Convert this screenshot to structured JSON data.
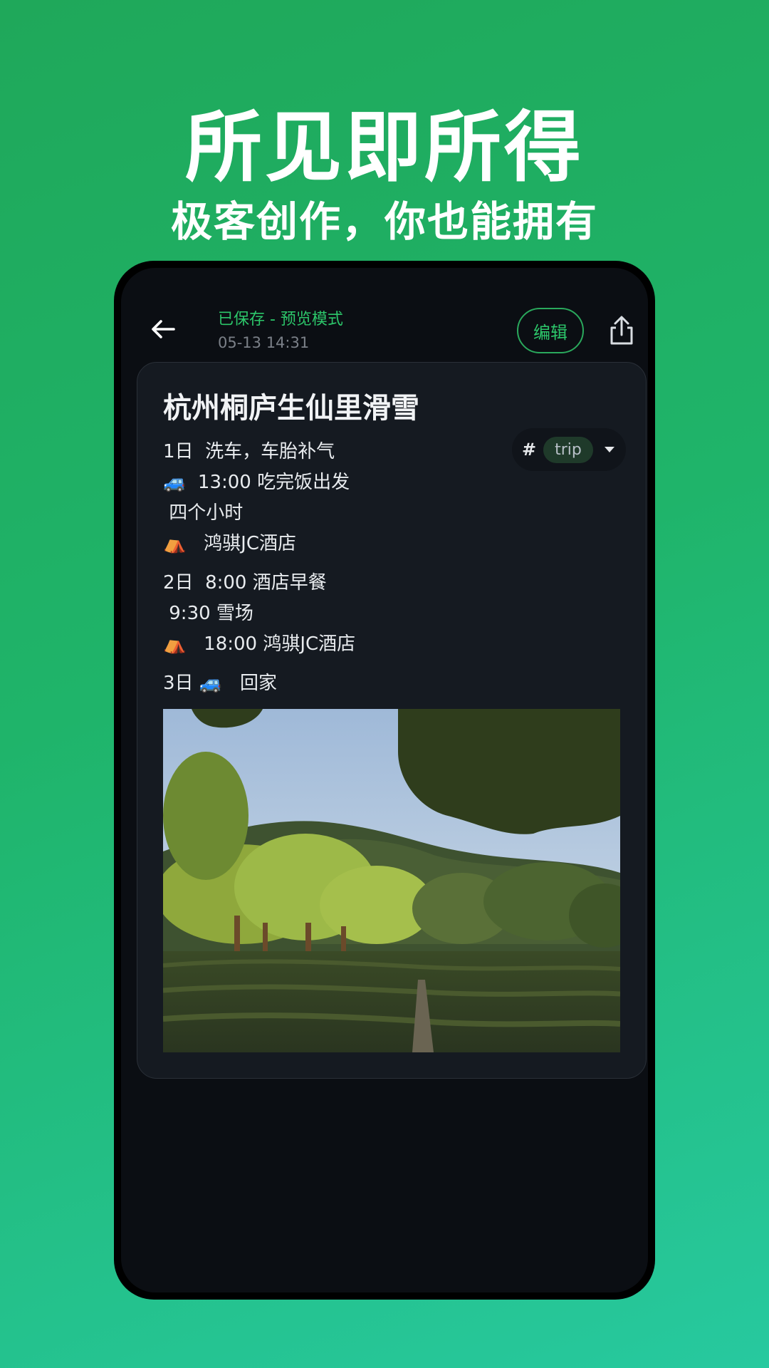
{
  "promo": {
    "title": "所见即所得",
    "subtitle": "极客创作，你也能拥有"
  },
  "header": {
    "status": "已保存 - 预览模式",
    "timestamp": "05-13 14:31",
    "edit_label": "编辑",
    "back_icon": "arrow-left-icon",
    "share_icon": "share-icon"
  },
  "note": {
    "title": "杭州桐庐生仙里滑雪",
    "tag": {
      "hash": "#",
      "label": "trip"
    },
    "lines": [
      "1日  洗车，车胎补气",
      "🚙  13:00 吃完饭出发",
      " 四个小时",
      "⛺   鸿骐JC酒店",
      "2日  8:00 酒店早餐",
      " 9:30 雪场",
      "⛺   18:00 鸿骐JC酒店",
      "3日 🚙   回家"
    ],
    "image_icon": "landscape-photo"
  },
  "colors": {
    "accent": "#2cc66a",
    "background_top": "#1fa85a",
    "background_bottom": "#27c99f",
    "screen_bg": "#0b0e13",
    "card_bg": "#151a21"
  }
}
